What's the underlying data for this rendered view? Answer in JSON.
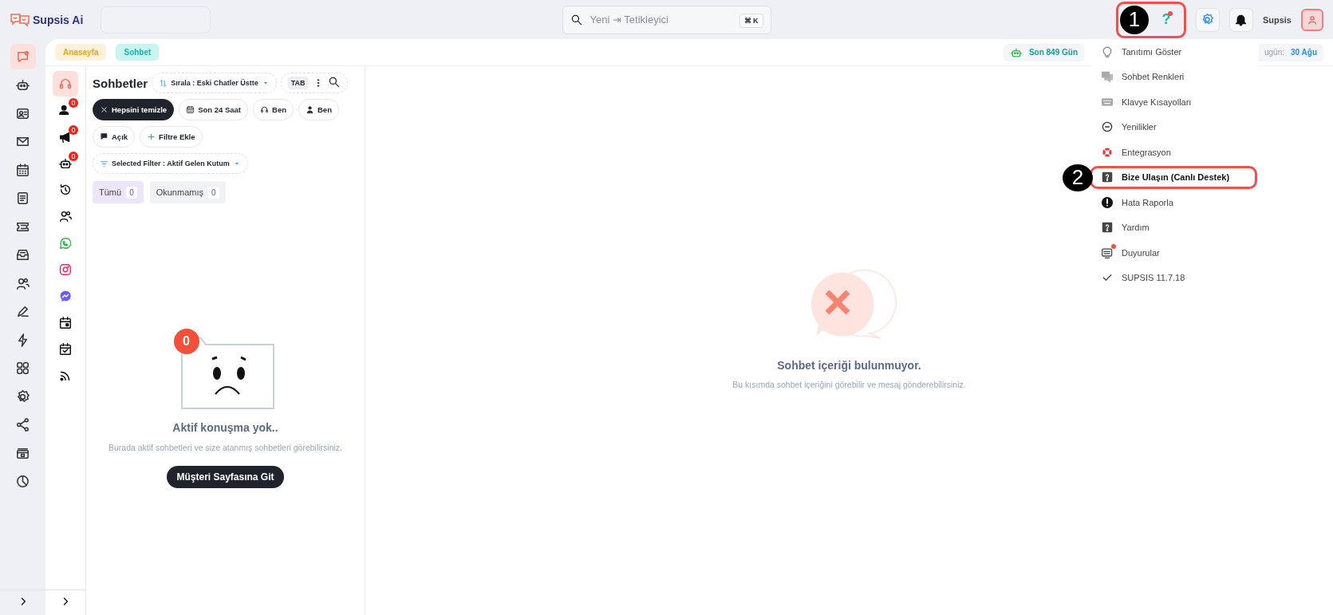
{
  "app": {
    "name": "Supsis Ai"
  },
  "topbar": {
    "search": {
      "placeholder": "Yeni ⇥ Tetikleyici",
      "shortcut": "⌘ K"
    },
    "help": {
      "icon_text": "?",
      "step": "1",
      "highlighted": true,
      "unread": true
    },
    "user": {
      "name": "Supsis"
    }
  },
  "breadcrumbs": [
    {
      "label": "Anasayfa",
      "color": "#f5a31a"
    },
    {
      "label": "Sohbet",
      "color": "#12b5a6"
    }
  ],
  "status_chips": [
    {
      "kind": "plan",
      "label": "Son 849 Gün"
    },
    {
      "kind": "date",
      "label": "ugün:",
      "value": "30 Ağu"
    }
  ],
  "nav_rail": {
    "items": [
      {
        "selected": true
      },
      {
        "selected": false
      },
      {
        "selected": false
      },
      {
        "selected": false
      },
      {
        "selected": false
      },
      {
        "selected": false
      },
      {
        "selected": false
      },
      {
        "selected": false
      },
      {
        "selected": false
      },
      {
        "selected": false
      },
      {
        "selected": false
      },
      {
        "selected": false
      },
      {
        "selected": false
      },
      {
        "selected": false
      },
      {
        "selected": false
      },
      {
        "selected": false
      }
    ]
  },
  "channel_rail": {
    "items": [
      {
        "selected": true
      },
      {
        "selected": false,
        "badge": "0"
      },
      {
        "selected": false,
        "badge": "0"
      },
      {
        "selected": false,
        "badge": "0"
      },
      {
        "selected": false
      },
      {
        "selected": false
      },
      {
        "selected": false
      },
      {
        "selected": false
      },
      {
        "selected": false
      },
      {
        "selected": false
      },
      {
        "selected": false
      },
      {
        "selected": false
      }
    ]
  },
  "chat_list": {
    "title": "Sohbetler",
    "sort": "Sırala : Eski Chatler Üstte",
    "tab_key": "TAB",
    "filters": [
      {
        "kind": "clear",
        "label": "Hepsini temizle"
      },
      {
        "kind": "filter",
        "label": "Son 24 Saat"
      },
      {
        "kind": "filter",
        "label": "Ben"
      },
      {
        "kind": "filter",
        "label": "Ben"
      },
      {
        "kind": "filter",
        "label": "Açık"
      },
      {
        "kind": "add",
        "label": "Filtre Ekle"
      }
    ],
    "selected_filter": "Selected Filter : Aktif Gelen Kutum",
    "tabs": [
      {
        "label": "Tümü",
        "count": "0",
        "selected": true
      },
      {
        "label": "Okunmamış",
        "count": "0",
        "selected": false
      }
    ],
    "empty": {
      "badge": "0",
      "title": "Aktif konuşma yok..",
      "text": "Burada aktif sohbetleri ve size atanmış sohbetleri görebilirsiniz.",
      "button": "Müşteri Sayfasına Git"
    }
  },
  "conversation": {
    "empty": {
      "title": "Sohbet içeriği bulunmuyor.",
      "text": "Bu kısımda sohbet içeriğini görebilir ve mesaj gönderebilirsiniz."
    }
  },
  "help_menu": {
    "items": [
      {
        "label": "Tanıtımı Göster",
        "highlighted": false,
        "unread": false
      },
      {
        "label": "Sohbet Renkleri",
        "highlighted": false,
        "unread": false
      },
      {
        "label": "Klavye Kısayolları",
        "highlighted": false,
        "unread": false
      },
      {
        "label": "Yenilikler",
        "highlighted": false,
        "unread": false
      },
      {
        "label": "Entegrasyon",
        "highlighted": false,
        "unread": false
      },
      {
        "label": "Bize Ulaşın (Canlı Destek)",
        "highlighted": true,
        "unread": false,
        "step": "2"
      },
      {
        "label": "Hata Raporla",
        "highlighted": false,
        "unread": false
      },
      {
        "label": "Yardım",
        "highlighted": false,
        "unread": false
      },
      {
        "label": "Duyurular",
        "highlighted": false,
        "unread": true
      },
      {
        "label": "SUPSIS 11.7.18",
        "highlighted": false,
        "unread": false
      }
    ]
  }
}
